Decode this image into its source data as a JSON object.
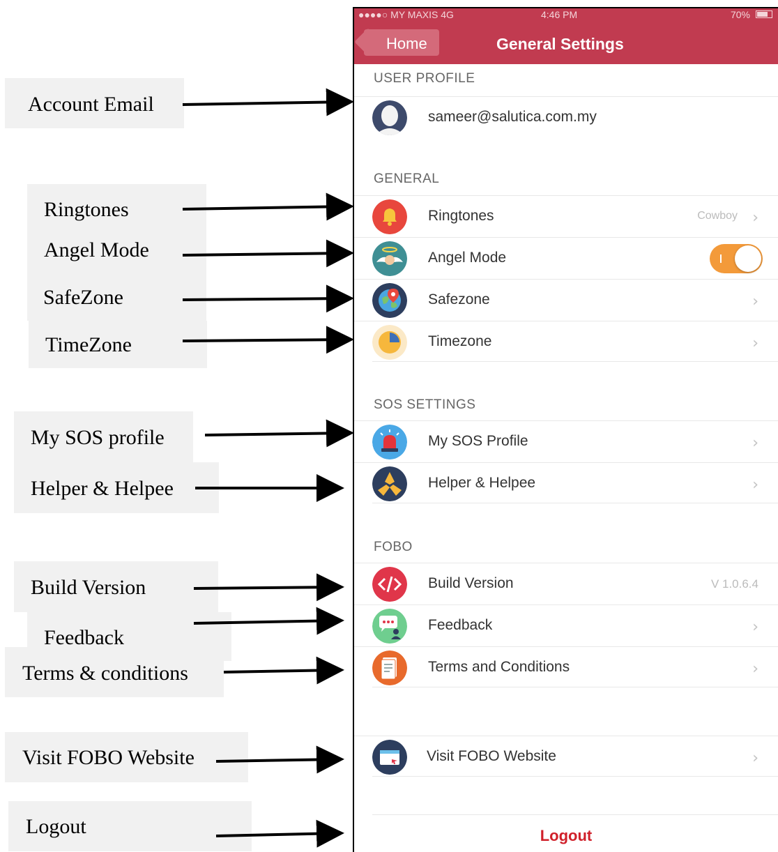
{
  "annotations": [
    {
      "label": "Account Email"
    },
    {
      "label": "Ringtones"
    },
    {
      "label": "Angel Mode"
    },
    {
      "label": "SafeZone"
    },
    {
      "label": "TimeZone"
    },
    {
      "label": "My SOS profile"
    },
    {
      "label": "Helper & Helpee"
    },
    {
      "label": "Build Version"
    },
    {
      "label": "Feedback"
    },
    {
      "label": "Terms & conditions"
    },
    {
      "label": "Visit FOBO Website"
    },
    {
      "label": "Logout"
    }
  ],
  "status_bar": {
    "carrier": "●●●●○ MY MAXIS  4G",
    "time": "4:46 PM",
    "battery": "70%"
  },
  "nav": {
    "back_label": "Home",
    "title": "General Settings"
  },
  "sections": {
    "user_profile": "USER PROFILE",
    "general": "GENERAL",
    "sos_settings": "SOS SETTINGS",
    "fobo": "FOBO"
  },
  "rows": {
    "email": "sameer@salutica.com.my",
    "ringtones": {
      "label": "Ringtones",
      "value": "Cowboy"
    },
    "angel_mode": {
      "label": "Angel Mode",
      "enabled": true
    },
    "safezone": {
      "label": "Safezone"
    },
    "timezone": {
      "label": "Timezone"
    },
    "my_sos_profile": {
      "label": "My SOS Profile"
    },
    "helper_helpee": {
      "label": "Helper & Helpee"
    },
    "build_version": {
      "label": "Build Version",
      "value": "V 1.0.6.4"
    },
    "feedback": {
      "label": "Feedback"
    },
    "terms": {
      "label": "Terms and Conditions"
    },
    "visit_website": {
      "label": "Visit FOBO Website"
    }
  },
  "logout_label": "Logout",
  "chevron": "›",
  "colors": {
    "nav_bar": "#c13b50",
    "toggle_on": "#f39a3a",
    "logout_text": "#d0202a"
  }
}
